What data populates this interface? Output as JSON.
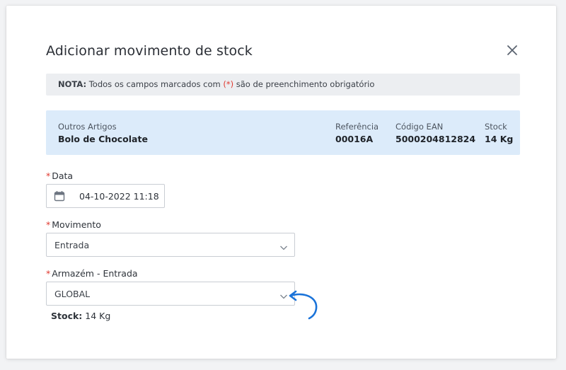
{
  "modal": {
    "title": "Adicionar movimento de stock",
    "close_icon": "close-icon"
  },
  "note": {
    "prefix": "NOTA:",
    "text_before": " Todos os campos marcados com ",
    "required_marker": "(*)",
    "text_after": " são de preenchimento obrigatório"
  },
  "item": {
    "category": "Outros Artigos",
    "name": "Bolo de Chocolate",
    "reference_label": "Referência",
    "reference_value": "00016A",
    "ean_label": "Código EAN",
    "ean_value": "5000204812824",
    "stock_label": "Stock",
    "stock_value": "14 Kg"
  },
  "form": {
    "date": {
      "required": "*",
      "label": "Data",
      "value": "04-10-2022 11:18",
      "icon": "calendar-icon"
    },
    "movement": {
      "required": "*",
      "label": "Movimento",
      "value": "Entrada",
      "icon": "chevron-down-icon"
    },
    "warehouse": {
      "required": "*",
      "label": "Armazém - Entrada",
      "value": "GLOBAL",
      "icon": "chevron-down-icon"
    },
    "stock": {
      "label": "Stock:",
      "value": " 14 Kg"
    }
  },
  "annotation": {
    "icon": "curved-arrow-icon",
    "color": "#1a73d9"
  },
  "colors": {
    "required": "#e0392f",
    "info_bg": "#dcebfa",
    "note_bg": "#eceef1"
  }
}
